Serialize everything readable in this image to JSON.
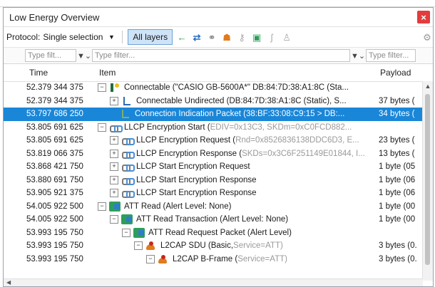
{
  "window": {
    "title": "Low Energy Overview"
  },
  "toolbar": {
    "protocol_label": "Protocol:",
    "protocol_value": "Single selection",
    "all_layers_label": "All layers"
  },
  "filters": {
    "time_placeholder": "Type filt...",
    "item_placeholder": "Type filter...",
    "payload_placeholder": "Type filter..."
  },
  "columns": {
    "time": "Time",
    "item": "Item",
    "payload": "Payload"
  },
  "rows": [
    {
      "time": "52.379 344 375",
      "indent": 0,
      "expander": "⊟",
      "icon": "conn",
      "text": "Connectable (\"CASIO GB-5600A*\" DB:84:7D:38:A1:8C (Sta...",
      "extra": "",
      "payload": ""
    },
    {
      "time": "52.379 344 375",
      "indent": 1,
      "expander": "⊞",
      "icon": "pkt",
      "text": "Connectable Undirected (DB:84:7D:38:A1:8C (Static), S...",
      "extra": "",
      "payload": "37 bytes ("
    },
    {
      "time": "53.797 686 250",
      "indent": 1,
      "expander": "",
      "icon": "pktsel",
      "text": "Connection Indication Packet (38:BF:33:08:C9:15 > DB:...",
      "extra": "",
      "payload": "34 bytes (",
      "selected": true
    },
    {
      "time": "53.805 691 625",
      "indent": 0,
      "expander": "⊟",
      "icon": "link",
      "text": "LLCP Encryption Start (",
      "extra": "EDIV=0x13C3, SKDm=0xC0FCD882...",
      "payload": ""
    },
    {
      "time": "53.805 691 625",
      "indent": 1,
      "expander": "⊞",
      "icon": "link",
      "text": "LLCP Encryption Request (",
      "extra": "Rnd=0x8526836138DDC6D3, E...",
      "payload": "23 bytes ("
    },
    {
      "time": "53.819 066 375",
      "indent": 1,
      "expander": "⊞",
      "icon": "link",
      "text": "LLCP Encryption Response (",
      "extra": "SKDs=0x3C6F251149E01844, I...",
      "payload": "13 bytes ("
    },
    {
      "time": "53.868 421 750",
      "indent": 1,
      "expander": "⊞",
      "icon": "link",
      "text": "LLCP Start Encryption Request",
      "extra": "",
      "payload": "1 byte (05"
    },
    {
      "time": "53.880 691 750",
      "indent": 1,
      "expander": "⊞",
      "icon": "link",
      "text": "LLCP Start Encryption Response",
      "extra": "",
      "payload": "1 byte (06"
    },
    {
      "time": "53.905 921 375",
      "indent": 1,
      "expander": "⊞",
      "icon": "link",
      "text": "LLCP Start Encryption Response",
      "extra": "",
      "payload": "1 byte (06"
    },
    {
      "time": "54.005 922 500",
      "indent": 0,
      "expander": "⊟",
      "icon": "att",
      "text": "ATT Read (Alert Level: None)",
      "extra": "",
      "payload": "1 byte (00"
    },
    {
      "time": "54.005 922 500",
      "indent": 1,
      "expander": "⊟",
      "icon": "att",
      "text": "ATT Read Transaction (Alert Level: None)",
      "extra": "",
      "payload": "1 byte (00"
    },
    {
      "time": "53.993 195 750",
      "indent": 2,
      "expander": "⊟",
      "icon": "att",
      "text": "ATT Read Request Packet (Alert Level)",
      "extra": "",
      "payload": ""
    },
    {
      "time": "53.993 195 750",
      "indent": 3,
      "expander": "⊟",
      "icon": "l2cap",
      "text": "L2CAP SDU (Basic, ",
      "extra": "Service=ATT)",
      "payload": "3 bytes (0."
    },
    {
      "time": "53.993 195 750",
      "indent": 4,
      "expander": "⊟",
      "icon": "l2cap",
      "text": "L2CAP B-Frame (",
      "extra": "Service=ATT)",
      "payload": "3 bytes (0."
    }
  ],
  "colors": {
    "selection": "#1a86d8",
    "close": "#e33c3c"
  }
}
